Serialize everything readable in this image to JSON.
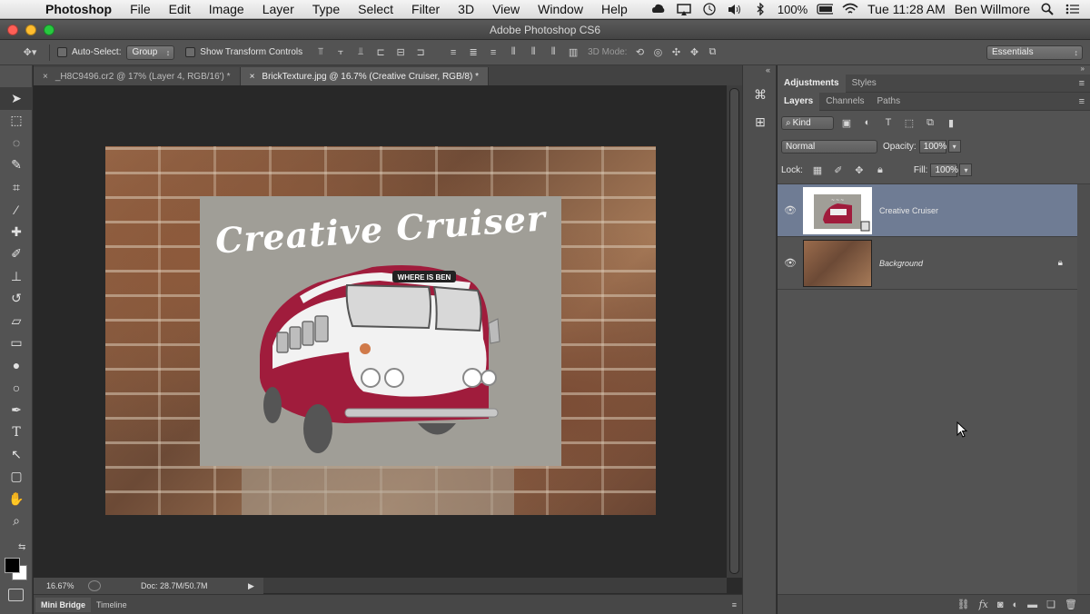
{
  "menubar": {
    "app_name": "Photoshop",
    "items": [
      "File",
      "Edit",
      "Image",
      "Layer",
      "Type",
      "Select",
      "Filter",
      "3D",
      "View",
      "Window",
      "Help"
    ],
    "battery": "100%",
    "clock": "Tue 11:28 AM",
    "user": "Ben Willmore"
  },
  "window": {
    "title": "Adobe Photoshop CS6"
  },
  "options": {
    "auto_select_label": "Auto-Select:",
    "auto_select_value": "Group",
    "show_transform_label": "Show Transform Controls",
    "mode_3d_label": "3D Mode:",
    "workspace": "Essentials"
  },
  "doc_tabs": [
    {
      "label": "_H8C9496.cr2 @ 17% (Layer 4, RGB/16') *"
    },
    {
      "label": "BrickTexture.jpg @ 16.7% (Creative Cruiser, RGB/8) *"
    }
  ],
  "artwork": {
    "headline": "Creative Cruiser",
    "sign": "WHERE IS BEN"
  },
  "status": {
    "zoom": "16.67%",
    "doc_size": "Doc: 28.7M/50.7M"
  },
  "bottom_tabs": [
    "Mini Bridge",
    "Timeline"
  ],
  "panels": {
    "top_tabs": [
      "Adjustments",
      "Styles"
    ],
    "layer_tabs": [
      "Layers",
      "Channels",
      "Paths"
    ],
    "filter_kind": "Kind",
    "blend_mode": "Normal",
    "opacity_label": "Opacity:",
    "opacity_value": "100%",
    "lock_label": "Lock:",
    "fill_label": "Fill:",
    "fill_value": "100%"
  },
  "layers": [
    {
      "name": "Creative Cruiser",
      "selected": true
    },
    {
      "name": "Background",
      "selected": false,
      "locked": true
    }
  ],
  "colors": {
    "bus_red": "#a01c3c",
    "artboard_gray": "#a09e97",
    "selected_layer": "#6f7c94",
    "ui_gray": "#535353"
  }
}
